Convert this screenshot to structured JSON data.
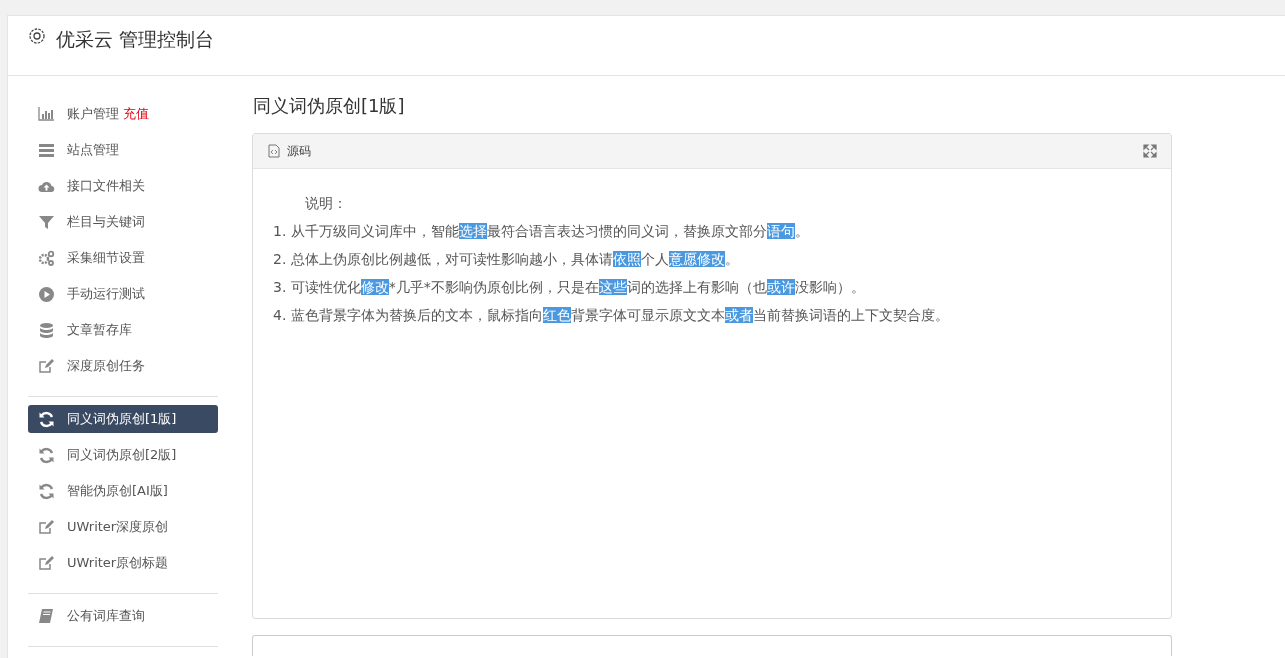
{
  "header": {
    "title": "优采云 管理控制台"
  },
  "sidebar": {
    "groups": [
      {
        "items": [
          {
            "label": "账户管理",
            "badge": "充值",
            "selected": false
          },
          {
            "label": "站点管理",
            "selected": false
          },
          {
            "label": "接口文件相关",
            "selected": false
          },
          {
            "label": "栏目与关键词",
            "selected": false
          },
          {
            "label": "采集细节设置",
            "selected": false
          },
          {
            "label": "手动运行测试",
            "selected": false
          },
          {
            "label": "文章暂存库",
            "selected": false
          },
          {
            "label": "深度原创任务",
            "selected": false
          }
        ]
      },
      {
        "items": [
          {
            "label": "同义词伪原创[1版]",
            "selected": true
          },
          {
            "label": "同义词伪原创[2版]",
            "selected": false
          },
          {
            "label": "智能伪原创[AI版]",
            "selected": false
          },
          {
            "label": "UWriter深度原创",
            "selected": false
          },
          {
            "label": "UWriter原创标题",
            "selected": false
          }
        ]
      },
      {
        "items": [
          {
            "label": "公有词库查询",
            "selected": false
          }
        ]
      }
    ]
  },
  "main": {
    "title": "同义词伪原创[1版]",
    "panel": {
      "toolbar_label": "源码",
      "intro": "说明：",
      "lines": [
        [
          {
            "text": "1. 从千万级同义词库中，智能",
            "highlighted": false
          },
          {
            "text": "选择",
            "highlighted": true
          },
          {
            "text": "最符合语言表达习惯的同义词，替换原文部分",
            "highlighted": false
          },
          {
            "text": "语句",
            "highlighted": true
          },
          {
            "text": "。",
            "highlighted": false
          }
        ],
        [
          {
            "text": "2. 总体上伪原创比例越低，对可读性影响越小，具体请",
            "highlighted": false
          },
          {
            "text": "依照",
            "highlighted": true
          },
          {
            "text": "个人",
            "highlighted": false
          },
          {
            "text": "意愿",
            "highlighted": true
          },
          {
            "text": "修改",
            "highlighted": true
          },
          {
            "text": "。",
            "highlighted": false
          }
        ],
        [
          {
            "text": "3. 可读性优化",
            "highlighted": false
          },
          {
            "text": "修改",
            "highlighted": true
          },
          {
            "text": "*几乎*不影响伪原创比例，只是在",
            "highlighted": false
          },
          {
            "text": "这些",
            "highlighted": true
          },
          {
            "text": "词的选择上有影响（也",
            "highlighted": false
          },
          {
            "text": "或许",
            "highlighted": true
          },
          {
            "text": "没影响）。",
            "highlighted": false
          }
        ],
        [
          {
            "text": "4. 蓝色背景字体为替换后的文本，鼠标指向",
            "highlighted": false
          },
          {
            "text": "红色",
            "highlighted": true
          },
          {
            "text": "背景字体可显示原文文本",
            "highlighted": false
          },
          {
            "text": "或者",
            "highlighted": true
          },
          {
            "text": "当前替换词语的上下文契合度。",
            "highlighted": false
          }
        ]
      ]
    }
  }
}
